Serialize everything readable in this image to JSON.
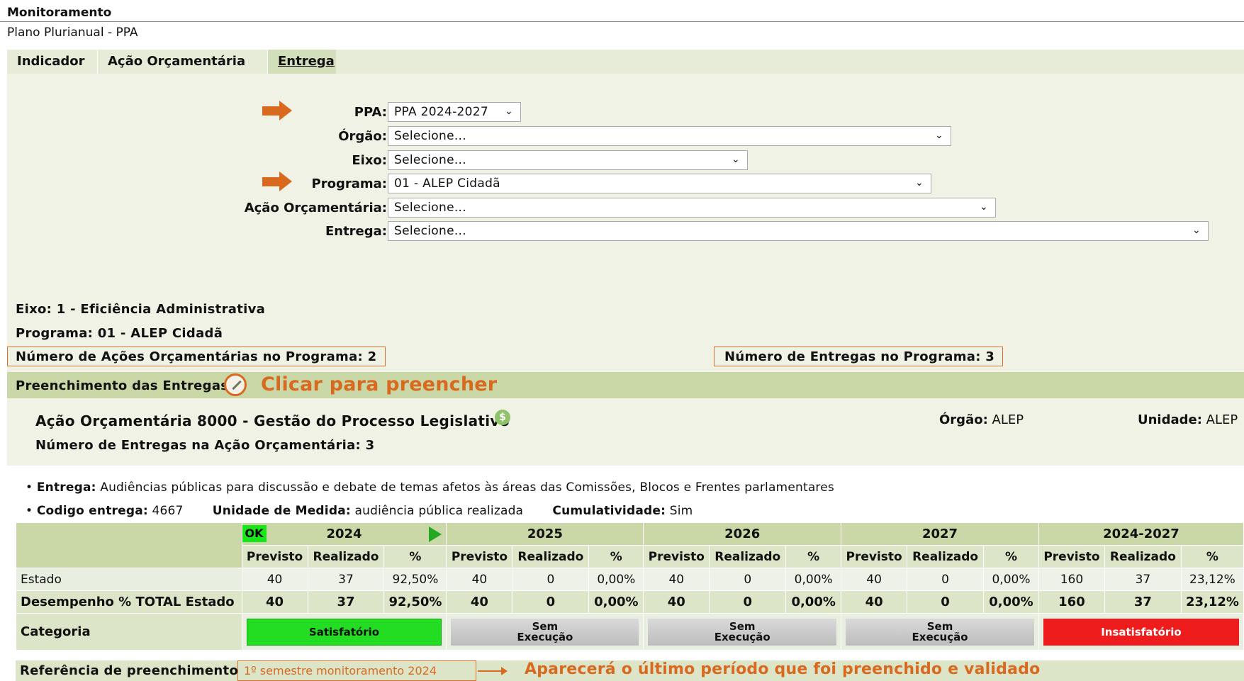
{
  "header": {
    "title": "Monitoramento",
    "subtitle": "Plano Plurianual - PPA"
  },
  "tabs": [
    {
      "label": "Indicador"
    },
    {
      "label": "Ação Orçamentária"
    },
    {
      "label": "Entrega"
    }
  ],
  "filters": {
    "ppa": {
      "label": "PPA:",
      "value": "PPA 2024-2027"
    },
    "orgao": {
      "label": "Órgão:",
      "value": "Selecione..."
    },
    "eixo": {
      "label": "Eixo:",
      "value": "Selecione..."
    },
    "programa": {
      "label": "Programa:",
      "value": "01 - ALEP Cidadã"
    },
    "acao": {
      "label": "Ação Orçamentária:",
      "value": "Selecione..."
    },
    "entrega": {
      "label": "Entrega:",
      "value": "Selecione..."
    }
  },
  "summary": {
    "eixo": "Eixo: 1 - Eficiência Administrativa",
    "programa": "Programa: 01 - ALEP Cidadã",
    "num_acoes": "Número de Ações Orçamentárias no Programa: 2",
    "num_entregas": "Número de Entregas no Programa: 3"
  },
  "preenchimento": {
    "label": "Preenchimento das Entregas",
    "callout": "Clicar para preencher"
  },
  "acao": {
    "title": "Ação Orçamentária 8000 - Gestão do Processo Legislativo",
    "num_entregas": "Número de Entregas na Ação Orçamentária: 3",
    "orgao_label": "Órgão:",
    "orgao_value": "ALEP",
    "unidade_label": "Unidade:",
    "unidade_value": "ALEP"
  },
  "entrega": {
    "label": "Entrega:",
    "text": "Audiências públicas para discussão e debate de temas afetos às áreas das Comissões, Blocos e Frentes parlamentares",
    "codigo_label": "Codigo entrega:",
    "codigo_value": "4667",
    "unidade_label": "Unidade de Medida:",
    "unidade_value": "audiência pública realizada",
    "cumul_label": "Cumulatividade:",
    "cumul_value": "Sim"
  },
  "table": {
    "ok_badge": "OK",
    "years": [
      "2024",
      "2025",
      "2026",
      "2027",
      "2024-2027"
    ],
    "subheaders": [
      "Previsto",
      "Realizado",
      "%"
    ],
    "rows": [
      {
        "label": "Estado",
        "values": [
          "40",
          "37",
          "92,50%",
          "40",
          "0",
          "0,00%",
          "40",
          "0",
          "0,00%",
          "40",
          "0",
          "0,00%",
          "160",
          "37",
          "23,12%"
        ]
      },
      {
        "label": "Desempenho % TOTAL Estado",
        "values": [
          "40",
          "37",
          "92,50%",
          "40",
          "0",
          "0,00%",
          "40",
          "0",
          "0,00%",
          "40",
          "0",
          "0,00%",
          "160",
          "37",
          "23,12%"
        ]
      }
    ],
    "categoria_label": "Categoria",
    "categorias": [
      {
        "line1": "Satisfatório",
        "line2": "",
        "color": "#22dd22"
      },
      {
        "line1": "Sem",
        "line2": "Execução",
        "color": "#c8c8c8"
      },
      {
        "line1": "Sem",
        "line2": "Execução",
        "color": "#c8c8c8"
      },
      {
        "line1": "Sem",
        "line2": "Execução",
        "color": "#c8c8c8"
      },
      {
        "line1": "Insatisfatório",
        "line2": "",
        "color": "#ee1c1c"
      }
    ]
  },
  "referencia": {
    "label": "Referência de preenchimento:",
    "value": "1º semestre monitoramento 2024",
    "callout": "Aparecerá o último período que foi preenchido e validado"
  },
  "colors": {
    "accent_orange": "#d8691f",
    "green_band": "#c9d8a6",
    "panel_bg": "#f0f2e6"
  }
}
